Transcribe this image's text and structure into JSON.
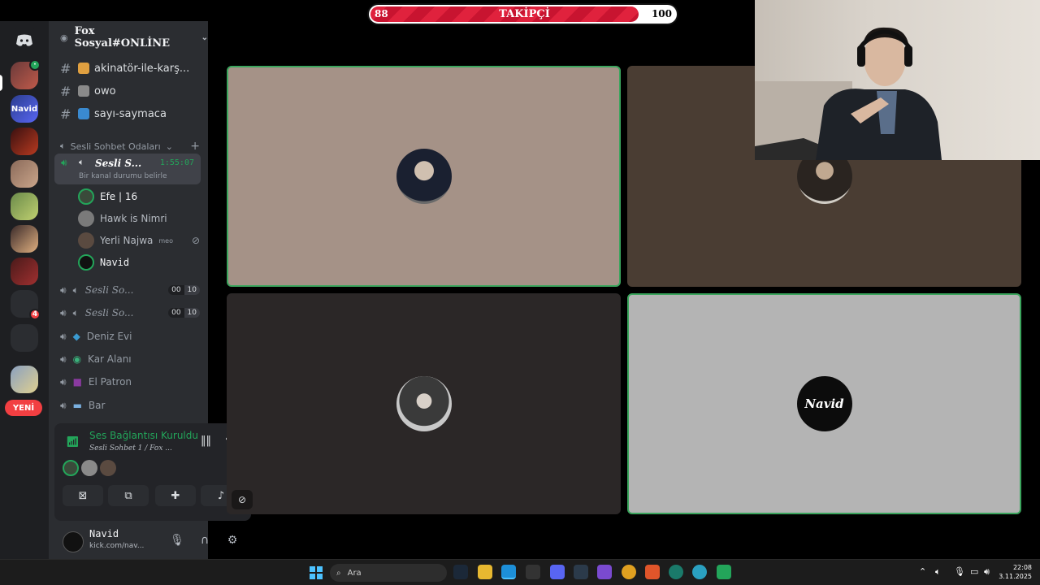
{
  "overlay": {
    "current": "88",
    "label": "TAKİPÇİ",
    "goal": "100",
    "progress": 0.88
  },
  "server": {
    "name": "Fox Sosyal#ONLİNE"
  },
  "rail": {
    "new_label": "YENİ",
    "badges": [
      "4"
    ]
  },
  "channels": [
    {
      "label": "akinatör-ile-karş..."
    },
    {
      "label": "owo"
    },
    {
      "label": "sayı-saymaca"
    }
  ],
  "category": {
    "label": "Sesli Sohbet Odaları"
  },
  "active_voice": {
    "name": "Sesli S...",
    "time": "1:55:07",
    "status": "Bir kanal durumu belirle"
  },
  "voice_users": [
    {
      "name": "Efe | 16"
    },
    {
      "name": "Hawk is Nimri"
    },
    {
      "name": "Yerli Najwa",
      "tag": "meo"
    },
    {
      "name": "Navid"
    }
  ],
  "voice_channels": [
    {
      "label": "Sesli So...",
      "count_a": "00",
      "count_b": "10"
    },
    {
      "label": "Sesli So...",
      "count_a": "00",
      "count_b": "10"
    },
    {
      "label": "Deniz Evi"
    },
    {
      "label": "Kar Alanı"
    },
    {
      "label": "El Patron"
    },
    {
      "label": "Bar"
    }
  ],
  "connection": {
    "status": "Ses Bağlantısı Kuruldu",
    "path": "Sesli Sohbet 1 / Fox ..."
  },
  "user_panel": {
    "name": "Navid",
    "sub": "kick.com/nav..."
  },
  "tiles": [
    {
      "speaking": true
    },
    {
      "speaking": false
    },
    {
      "speaking": false
    },
    {
      "speaking": true,
      "avatar_text": "Navid"
    }
  ],
  "taskbar": {
    "search_placeholder": "Ara",
    "time": "22:08",
    "date": "3.11.2025"
  },
  "colors": {
    "online": "#23a55a",
    "danger": "#f23f42",
    "sidebar": "#2b2d31",
    "rail": "#1e1f22"
  }
}
